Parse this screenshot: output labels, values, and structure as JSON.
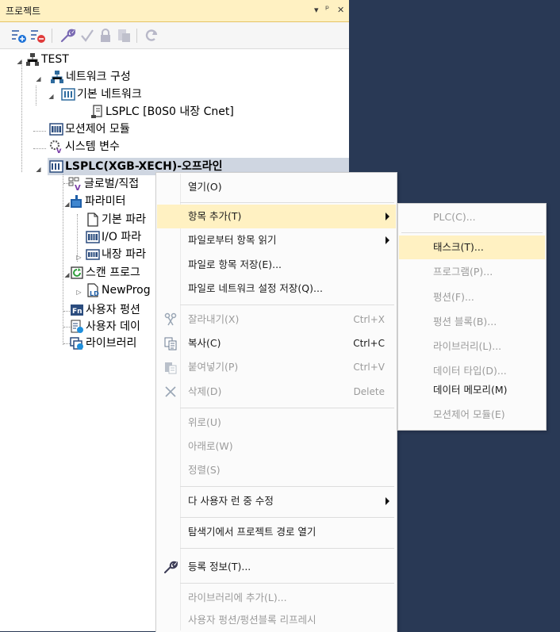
{
  "panel": {
    "title": "프로젝트",
    "pin_glyph": "▾",
    "dock_glyph": "ᵖ",
    "close_glyph": "✕"
  },
  "toolbar": {
    "icons": [
      "collapse-blue-icon",
      "collapse-red-icon",
      "wrench-icon",
      "check-icon",
      "lock-icon",
      "save-icon",
      "refresh-icon"
    ]
  },
  "tree": {
    "items": [
      {
        "label": "TEST"
      },
      {
        "label": "네트워크 구성"
      },
      {
        "label": "기본 네트워크"
      },
      {
        "label": "LSPLC  [B0S0 내장 Cnet]"
      },
      {
        "label": "모션제어 모듈"
      },
      {
        "label": "시스템 변수"
      },
      {
        "label": "LSPLC(XGB-XECH)-오프라인"
      },
      {
        "label": "글로벌/직접"
      },
      {
        "label": "파라미터"
      },
      {
        "label": "기본 파라"
      },
      {
        "label": "I/O 파라"
      },
      {
        "label": "내장 파라"
      },
      {
        "label": "스캔 프로그"
      },
      {
        "label": "NewProg"
      },
      {
        "label": "사용자 펑션"
      },
      {
        "label": "사용자 데이"
      },
      {
        "label": "라이브러리"
      }
    ]
  },
  "context_menu": {
    "items": [
      {
        "label": "열기(O)",
        "shortcut": "",
        "disabled": false
      },
      {
        "label": "항목 추가(T)",
        "shortcut": "",
        "disabled": false
      },
      {
        "label": "파일로부터 항목 읽기",
        "shortcut": "",
        "disabled": false
      },
      {
        "label": "파일로 항목 저장(E)...",
        "shortcut": "",
        "disabled": false
      },
      {
        "label": "파일로 네트워크 설정 저장(Q)...",
        "shortcut": "",
        "disabled": false
      },
      {
        "label": "잘라내기(X)",
        "shortcut": "Ctrl+X",
        "disabled": true
      },
      {
        "label": "복사(C)",
        "shortcut": "Ctrl+C",
        "disabled": false
      },
      {
        "label": "붙여넣기(P)",
        "shortcut": "Ctrl+V",
        "disabled": true
      },
      {
        "label": "삭제(D)",
        "shortcut": "Delete",
        "disabled": true
      },
      {
        "label": "위로(U)",
        "shortcut": "",
        "disabled": true
      },
      {
        "label": "아래로(W)",
        "shortcut": "",
        "disabled": true
      },
      {
        "label": "정렬(S)",
        "shortcut": "",
        "disabled": true
      },
      {
        "label": "다 사용자 런 중 수정",
        "shortcut": "",
        "disabled": false
      },
      {
        "label": "탐색기에서 프로젝트 경로 열기",
        "shortcut": "",
        "disabled": false
      },
      {
        "label": "등록 정보(T)...",
        "shortcut": "",
        "disabled": false
      },
      {
        "label": "라이브러리에 추가(L)...",
        "shortcut": "",
        "disabled": true
      },
      {
        "label": "사용자 펑션/펑션블록 리프레시",
        "shortcut": "",
        "disabled": true
      }
    ]
  },
  "submenu": {
    "items": [
      {
        "label": "PLC(C)...",
        "disabled": true
      },
      {
        "label": "태스크(T)...",
        "disabled": false
      },
      {
        "label": "프로그램(P)...",
        "disabled": true
      },
      {
        "label": "펑션(F)...",
        "disabled": true
      },
      {
        "label": "펑션 블록(B)...",
        "disabled": true
      },
      {
        "label": "라이브러리(L)...",
        "disabled": true
      },
      {
        "label": "데이터 타입(D)...",
        "disabled": true
      },
      {
        "label": "데이터 메모리(M)",
        "disabled": false
      },
      {
        "label": "모션제어 모듈(E)",
        "disabled": true
      }
    ]
  },
  "colors": {
    "background": "#293955",
    "highlight": "#fff1c2",
    "selection": "#cfd6e1",
    "disabled_text": "#9b9b9b"
  }
}
